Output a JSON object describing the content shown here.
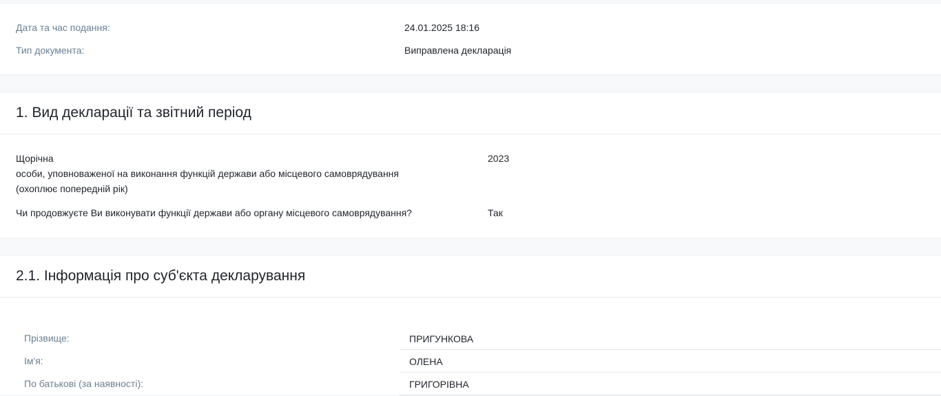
{
  "meta": {
    "submitted_label": "Дата та час подання:",
    "submitted_value": "24.01.2025 18:16",
    "doc_type_label": "Тип документа:",
    "doc_type_value": "Виправлена декларація"
  },
  "section1": {
    "title": "1. Вид декларації та звітний період",
    "kind_line1": "Щорічна",
    "kind_line2": "особи, уповноваженої на виконання функцій держави або місцевого самоврядування (охоплює попередній рік)",
    "year": "2023",
    "question": "Чи продовжуєте Ви виконувати функції держави або органу місцевого самоврядування?",
    "answer": "Так"
  },
  "section2": {
    "title": "2.1. Інформація про суб'єкта декларування",
    "fields": [
      {
        "label": "Прізвище:",
        "value": "ПРИГУНКОВА"
      },
      {
        "label": "Ім'я:",
        "value": "ОЛЕНА"
      },
      {
        "label": "По батькові (за наявності):",
        "value": "ГРИГОРІВНА"
      }
    ]
  }
}
